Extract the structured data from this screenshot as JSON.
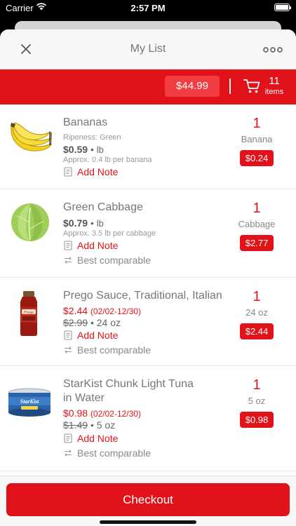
{
  "status_bar": {
    "carrier": "Carrier",
    "time": "2:57 PM"
  },
  "nav": {
    "title": "My List",
    "close_icon": "close-icon",
    "more_icon": "more-icon"
  },
  "summary": {
    "total": "$44.99",
    "item_count": "11",
    "items_label": "items"
  },
  "colors": {
    "brand_red": "#e1121a",
    "pill_red": "#f13c42",
    "text_grey": "#777777"
  },
  "actions": {
    "add_note": "Add Note",
    "best_comparable": "Best comparable"
  },
  "items": [
    {
      "name": "Bananas",
      "ripeness": "Ripeness: Green",
      "price": "$0.59",
      "unit": "lb",
      "approx": "Approx. 0.4 lb per banana",
      "qty": "1",
      "qty_unit": "Banana",
      "line_total": "$0.24"
    },
    {
      "name": "Green Cabbage",
      "price": "$0.79",
      "unit": "lb",
      "approx": "Approx. 3.5 lb per cabbage",
      "qty": "1",
      "qty_unit": "Cabbage",
      "line_total": "$2.77"
    },
    {
      "name": "Prego Sauce, Traditional, Italian",
      "sale_price": "$2.44",
      "sale_dates": "(02/02-12/30)",
      "was_price": "$2.99",
      "size": "24 oz",
      "qty": "1",
      "qty_unit": "24 oz",
      "line_total": "$2.44"
    },
    {
      "name_line1": "StarKist Chunk Light Tuna",
      "name_line2": "in Water",
      "sale_price": "$0.98",
      "sale_dates": "(02/02-12/30)",
      "was_price": "$1.49",
      "size": "5 oz",
      "qty": "1",
      "qty_unit": "5 oz",
      "line_total": "$0.98"
    }
  ],
  "footer": {
    "checkout_label": "Checkout"
  }
}
